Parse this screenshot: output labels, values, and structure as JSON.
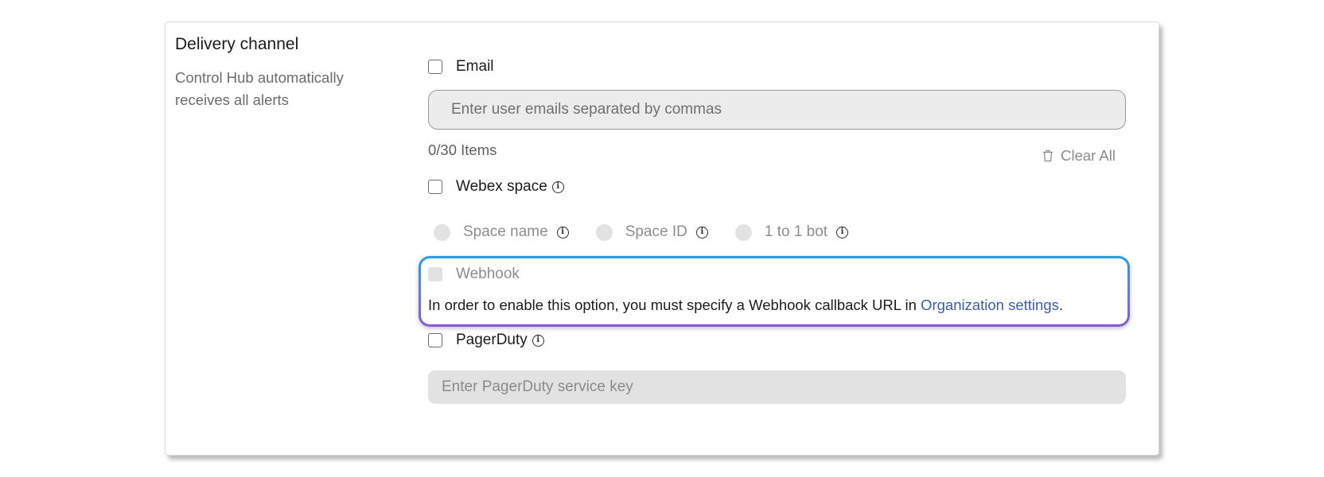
{
  "section": {
    "title": "Delivery channel",
    "description": "Control Hub automatically receives all alerts"
  },
  "email": {
    "label": "Email",
    "checked": false,
    "placeholder": "Enter user emails separated by commas",
    "value": "",
    "items_count": "0/30 Items",
    "clear_all_label": "Clear All"
  },
  "webex_space": {
    "label": "Webex space",
    "checked": false,
    "info_icon": "info-icon",
    "options": [
      {
        "label": "Space name",
        "selected": false,
        "disabled": true
      },
      {
        "label": "Space ID",
        "selected": false,
        "disabled": true
      },
      {
        "label": "1 to 1 bot",
        "selected": false,
        "disabled": true
      }
    ]
  },
  "webhook": {
    "label": "Webhook",
    "checked": false,
    "disabled": true,
    "note_prefix": "In order to enable this option, you must specify a Webhook callback URL in ",
    "link_text": "Organization settings",
    "note_suffix": ".",
    "highlight_colors": [
      "#2a9be6",
      "#8957dc"
    ]
  },
  "pagerduty": {
    "label": "PagerDuty",
    "checked": false,
    "placeholder": "Enter PagerDuty service key",
    "value": ""
  },
  "icons": {
    "info": "i",
    "trash": "trash-icon"
  },
  "colors": {
    "link": "#3a5ea8",
    "disabled_text": "#8d8d8d",
    "disabled_fill": "#e2e2e2"
  }
}
